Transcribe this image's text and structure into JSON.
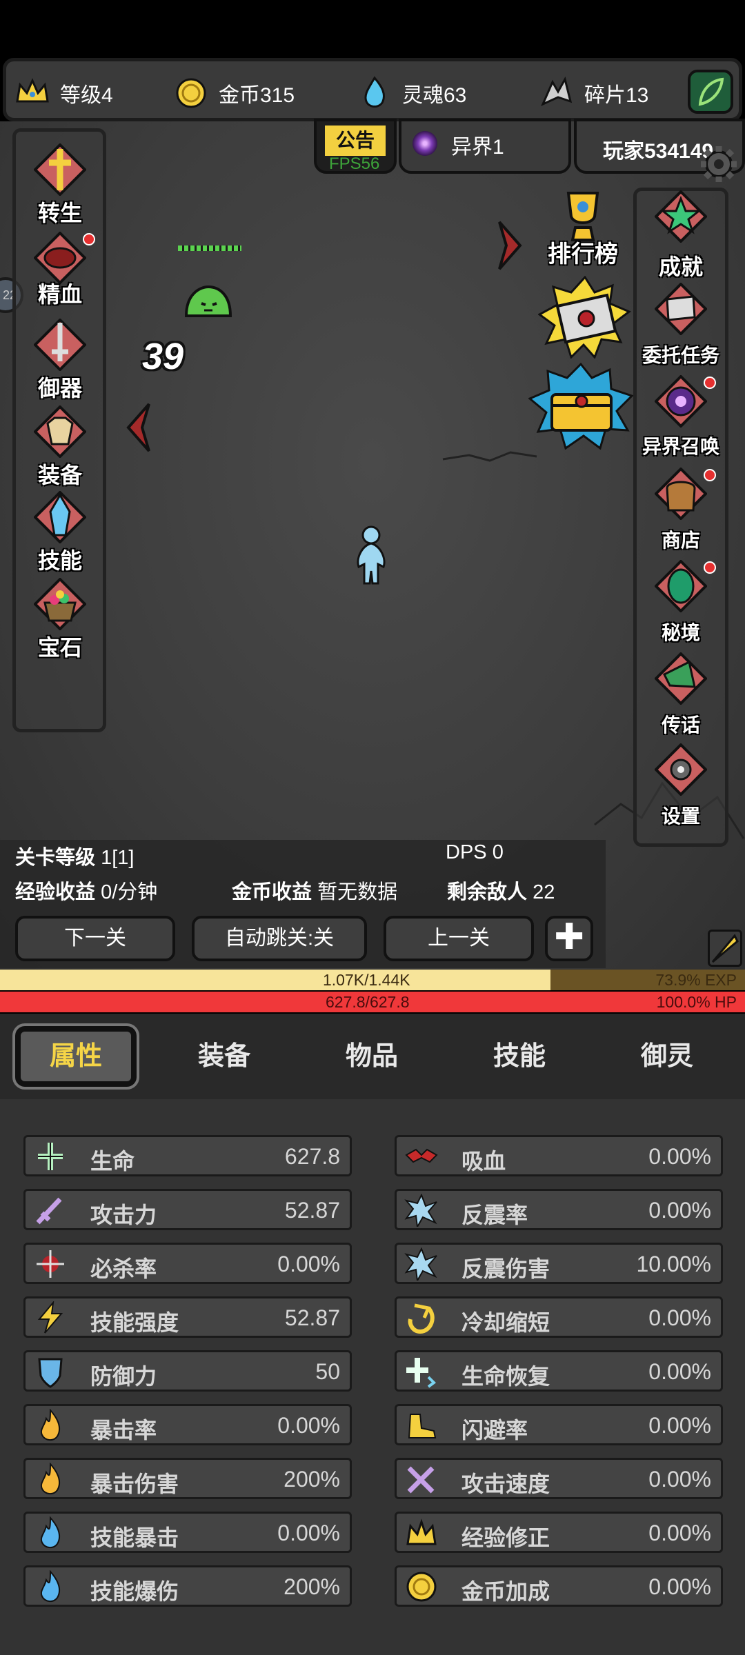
{
  "resources": {
    "level": "等级4",
    "gold": "金币315",
    "soul": "灵魂63",
    "shards": "碎片13"
  },
  "top_tabs": {
    "notice": "公告",
    "fps": "FPS56",
    "world": "异界1",
    "player": "玩家534149"
  },
  "left_menu": [
    {
      "label": "转生"
    },
    {
      "label": "精血"
    },
    {
      "label": "御器"
    },
    {
      "label": "装备"
    },
    {
      "label": "技能"
    },
    {
      "label": "宝石"
    }
  ],
  "right_menu": [
    {
      "label": "成就"
    },
    {
      "label": "委托任务"
    },
    {
      "label": "异界召唤"
    },
    {
      "label": "商店"
    },
    {
      "label": "秘境"
    },
    {
      "label": "传话"
    },
    {
      "label": "设置"
    }
  ],
  "leaderboard": "排行榜",
  "battle": {
    "damage_number": "39",
    "side_badge": "22"
  },
  "stage": {
    "level_label": "关卡等级",
    "level_value": "1[1]",
    "dps_label": "DPS",
    "dps_value": "0",
    "exp_label": "经验收益",
    "exp_value": "0/分钟",
    "gold_label": "金币收益",
    "gold_value": "暂无数据",
    "enemies_label": "剩余敌人",
    "enemies_value": "22",
    "btn_next": "下一关",
    "btn_auto": "自动跳关:关",
    "btn_prev": "上一关"
  },
  "exp_bar": {
    "text": "1.07K/1.44K",
    "percent_text": "73.9% EXP",
    "fill_fraction": 0.739
  },
  "hp_bar": {
    "text": "627.8/627.8",
    "percent_text": "100.0%   HP",
    "fill_fraction": 1.0
  },
  "main_tabs": [
    {
      "label": "属性"
    },
    {
      "label": "装备"
    },
    {
      "label": "物品"
    },
    {
      "label": "技能"
    },
    {
      "label": "御灵"
    }
  ],
  "stats_left": [
    {
      "name": "生命",
      "value": "627.8",
      "icon": "life-icon"
    },
    {
      "name": "攻击力",
      "value": "52.87",
      "icon": "sword-icon"
    },
    {
      "name": "必杀率",
      "value": "0.00%",
      "icon": "kill-icon"
    },
    {
      "name": "技能强度",
      "value": "52.87",
      "icon": "lightning-icon"
    },
    {
      "name": "防御力",
      "value": "50",
      "icon": "shield-icon"
    },
    {
      "name": "暴击率",
      "value": "0.00%",
      "icon": "fire-icon"
    },
    {
      "name": "暴击伤害",
      "value": "200%",
      "icon": "fire-icon"
    },
    {
      "name": "技能暴击",
      "value": "0.00%",
      "icon": "blue-fire-icon"
    },
    {
      "name": "技能爆伤",
      "value": "200%",
      "icon": "blue-fire-icon"
    }
  ],
  "stats_right": [
    {
      "name": "吸血",
      "value": "0.00%",
      "icon": "bat-icon"
    },
    {
      "name": "反震率",
      "value": "0.00%",
      "icon": "shatter-icon"
    },
    {
      "name": "反震伤害",
      "value": "10.00%",
      "icon": "shatter-icon"
    },
    {
      "name": "冷却缩短",
      "value": "0.00%",
      "icon": "cooldown-icon"
    },
    {
      "name": "生命恢复",
      "value": "0.00%",
      "icon": "regen-icon"
    },
    {
      "name": "闪避率",
      "value": "0.00%",
      "icon": "boot-icon"
    },
    {
      "name": "攻击速度",
      "value": "0.00%",
      "icon": "swords-icon"
    },
    {
      "name": "经验修正",
      "value": "0.00%",
      "icon": "crown-icon"
    },
    {
      "name": "金币加成",
      "value": "0.00%",
      "icon": "coin-icon"
    }
  ],
  "colors": {
    "accent_yellow": "#f5d547",
    "hp_red": "#f0383a",
    "exp_yellow": "#f7e49a",
    "panel_dark": "#333333"
  }
}
